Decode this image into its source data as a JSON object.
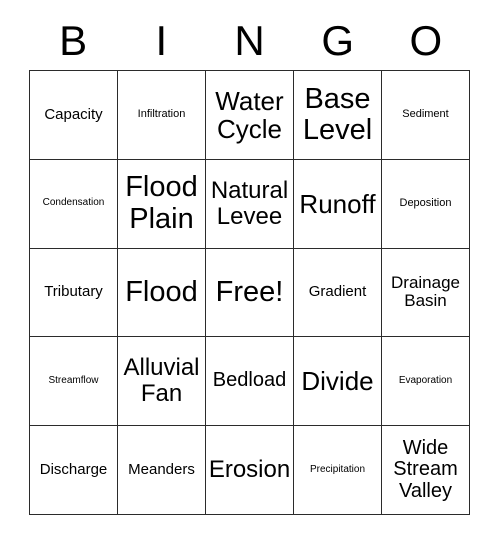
{
  "card": {
    "title": "BINGO",
    "header_letters": [
      "B",
      "I",
      "N",
      "G",
      "O"
    ],
    "border_color": "#2b2b2b",
    "background_color": "#ffffff",
    "text_color": "#000000",
    "rows": 5,
    "columns": 5,
    "cells": [
      {
        "text": "Capacity",
        "size": "fs-m"
      },
      {
        "text": "Infiltration",
        "size": "fs-s"
      },
      {
        "text": "Water\nCycle",
        "size": "fs-xxl"
      },
      {
        "text": "Base\nLevel",
        "size": "fs-3xl"
      },
      {
        "text": "Sediment",
        "size": "fs-s"
      },
      {
        "text": "Condensation",
        "size": "fs-xs"
      },
      {
        "text": "Flood\nPlain",
        "size": "fs-3xl"
      },
      {
        "text": "Natural\nLevee",
        "size": "fs-xl"
      },
      {
        "text": "Runoff",
        "size": "fs-xxl"
      },
      {
        "text": "Deposition",
        "size": "fs-s"
      },
      {
        "text": "Tributary",
        "size": "fs-m"
      },
      {
        "text": "Flood",
        "size": "fs-3xl"
      },
      {
        "text": "Free!",
        "size": "fs-3xl"
      },
      {
        "text": "Gradient",
        "size": "fs-m"
      },
      {
        "text": "Drainage\nBasin",
        "size": "fs-ml"
      },
      {
        "text": "Streamflow",
        "size": "fs-xs"
      },
      {
        "text": "Alluvial\nFan",
        "size": "fs-xl"
      },
      {
        "text": "Bedload",
        "size": "fs-l"
      },
      {
        "text": "Divide",
        "size": "fs-xxl"
      },
      {
        "text": "Evaporation",
        "size": "fs-xs"
      },
      {
        "text": "Discharge",
        "size": "fs-m"
      },
      {
        "text": "Meanders",
        "size": "fs-m"
      },
      {
        "text": "Erosion",
        "size": "fs-xl"
      },
      {
        "text": "Precipitation",
        "size": "fs-xs"
      },
      {
        "text": "Wide\nStream\nValley",
        "size": "fs-l"
      }
    ]
  }
}
